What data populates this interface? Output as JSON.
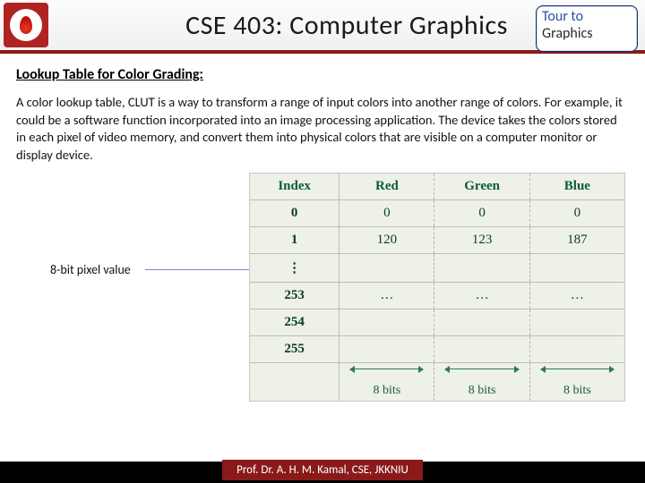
{
  "header": {
    "title": "CSE 403: Computer Graphics",
    "tag_line1": "Tour to",
    "tag_line2": "Graphics"
  },
  "section": {
    "title": "Lookup Table for Color Grading:",
    "body": "A color lookup table, CLUT is a way to transform a range of input colors into another range of colors. For example, it could be a software function incorporated into an image processing application. The device takes the colors stored in each pixel of video memory, and convert them into physical colors that are visible on a computer monitor or display device."
  },
  "annotation": "8-bit pixel value",
  "table": {
    "headers": [
      "Index",
      "Red",
      "Green",
      "Blue"
    ],
    "rows": [
      {
        "index": "0",
        "red": "0",
        "green": "0",
        "blue": "0"
      },
      {
        "index": "1",
        "red": "120",
        "green": "123",
        "blue": "187"
      },
      {
        "index": "⋮",
        "red": "",
        "green": "",
        "blue": ""
      },
      {
        "index": "253",
        "red": "…",
        "green": "…",
        "blue": "…"
      },
      {
        "index": "254",
        "red": "",
        "green": "",
        "blue": ""
      },
      {
        "index": "255",
        "red": "",
        "green": "",
        "blue": ""
      }
    ],
    "bits_label": "8 bits"
  },
  "footer": "Prof. Dr. A. H. M. Kamal, CSE, JKKNIU"
}
